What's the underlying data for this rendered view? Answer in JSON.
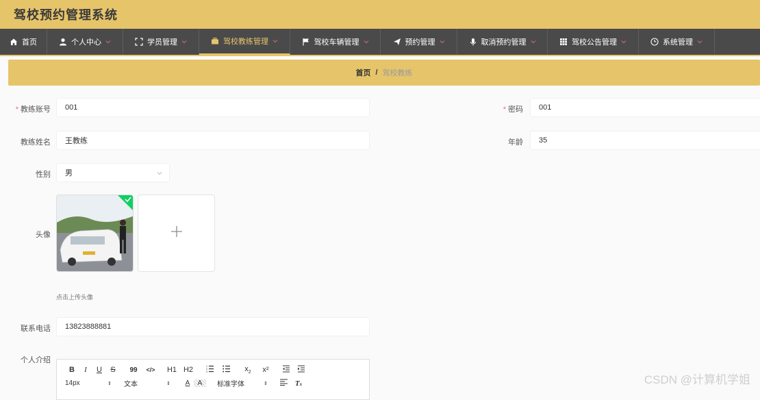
{
  "app": {
    "title": "驾校预约管理系统"
  },
  "nav": {
    "items": [
      {
        "label": "首页",
        "icon": "home-icon",
        "has_menu": false,
        "active": false
      },
      {
        "label": "个人中心",
        "icon": "user-icon",
        "has_menu": true,
        "active": false
      },
      {
        "label": "学员管理",
        "icon": "fullscreen-icon",
        "has_menu": true,
        "active": false
      },
      {
        "label": "驾校教练管理",
        "icon": "briefcase-icon",
        "has_menu": true,
        "active": true
      },
      {
        "label": "驾校车辆管理",
        "icon": "flag-icon",
        "has_menu": true,
        "active": false
      },
      {
        "label": "预约管理",
        "icon": "send-icon",
        "has_menu": true,
        "active": false
      },
      {
        "label": "取消预约管理",
        "icon": "microphone-icon",
        "has_menu": true,
        "active": false
      },
      {
        "label": "驾校公告管理",
        "icon": "grid-icon",
        "has_menu": true,
        "active": false
      },
      {
        "label": "系统管理",
        "icon": "clock-icon",
        "has_menu": true,
        "active": false
      }
    ]
  },
  "breadcrumb": {
    "home": "首页",
    "separator": "/",
    "current": "驾校教练"
  },
  "form": {
    "coach_account": {
      "label": "教练账号",
      "value": "001"
    },
    "password": {
      "label": "密码",
      "value": "001"
    },
    "coach_name": {
      "label": "教练姓名",
      "value": "王教练"
    },
    "age": {
      "label": "年龄",
      "value": "35"
    },
    "gender": {
      "label": "性别",
      "value": "男"
    },
    "avatar": {
      "label": "头像",
      "tip": "点击上传头像"
    },
    "phone": {
      "label": "联系电话",
      "value": "13823888881"
    },
    "intro": {
      "label": "个人介绍"
    }
  },
  "editor_toolbar": {
    "row1": [
      "B",
      "I",
      "U",
      "S",
      "99",
      "</>",
      "H1",
      "H2",
      "ol",
      "ul",
      "x2",
      "x²",
      "outdent",
      "indent"
    ],
    "font_size": "14px",
    "paragraph": "文本",
    "font_family": "标准字体"
  },
  "watermark": "CSDN @计算机学姐",
  "colors": {
    "accent": "#e6c46a",
    "nav_bg": "#4a4a4a",
    "required": "#f56c6c"
  }
}
